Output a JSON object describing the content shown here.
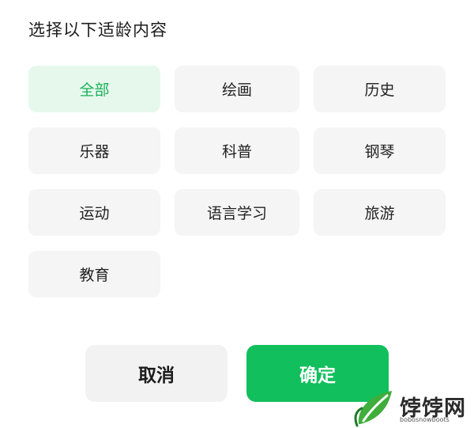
{
  "dialog": {
    "title": "选择以下适龄内容",
    "options": [
      {
        "label": "全部",
        "selected": true
      },
      {
        "label": "绘画",
        "selected": false
      },
      {
        "label": "历史",
        "selected": false
      },
      {
        "label": "乐器",
        "selected": false
      },
      {
        "label": "科普",
        "selected": false
      },
      {
        "label": "钢琴",
        "selected": false
      },
      {
        "label": "运动",
        "selected": false
      },
      {
        "label": "语言学习",
        "selected": false
      },
      {
        "label": "旅游",
        "selected": false
      },
      {
        "label": "教育",
        "selected": false
      }
    ],
    "cancel_label": "取消",
    "confirm_label": "确定"
  },
  "watermark": {
    "text": "饽饽网",
    "sub": "bobosnowboots"
  },
  "colors": {
    "accent": "#12bf5d",
    "selected_bg": "#e6f8ec",
    "selected_text": "#1ab05a",
    "option_bg": "#f5f5f5"
  }
}
